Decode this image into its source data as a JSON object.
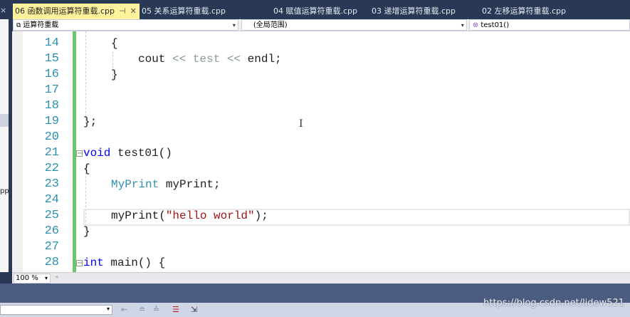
{
  "tabs": [
    {
      "label": "06 函数调用运算符重载.cpp",
      "active": true
    },
    {
      "label": "05 关系运算符重载.cpp"
    },
    {
      "label": "04 赋值运算符重载.cpp"
    },
    {
      "label": "03 递增运算符重载.cpp"
    },
    {
      "label": "02 左移运算符重载.cpp"
    }
  ],
  "tab_pin": "⊣",
  "tab_close": "✕",
  "navbar": {
    "project": "运算符重载",
    "scope": "(全局范围)",
    "member": "test01()"
  },
  "left_panel": {
    "close": "×",
    "fragment": "pp"
  },
  "line_numbers": [
    "14",
    "15",
    "16",
    "17",
    "18",
    "19",
    "20",
    "21",
    "22",
    "23",
    "24",
    "25",
    "26",
    "27",
    "28"
  ],
  "code": {
    "l14": "{",
    "l15_a": "cout ",
    "l15_b": "<<",
    "l15_c": " test ",
    "l15_d": "<<",
    "l15_e": " endl;",
    "l16": "}",
    "l19": "};",
    "l21_kw": "void",
    "l21_rest": " test01()",
    "l22": "{",
    "l23_type": "MyPrint",
    "l23_rest": " myPrint;",
    "l25_a": "myPrint(",
    "l25_str": "\"hello world\"",
    "l25_b": ");",
    "l26": "}",
    "l28_kw": "int",
    "l28_rest": " main() {"
  },
  "zoom": "100 %",
  "watermark": "https://blog.csdn.net/lidew521"
}
